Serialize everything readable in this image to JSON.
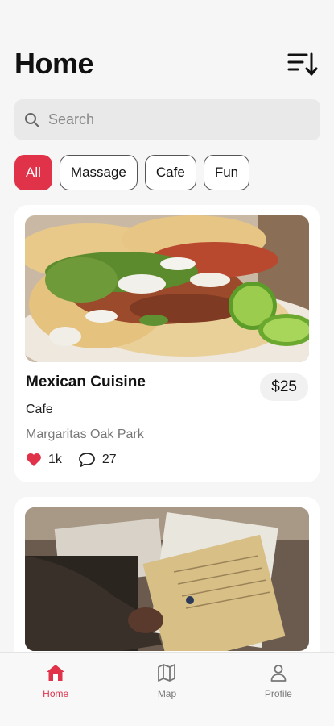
{
  "header": {
    "title": "Home"
  },
  "search": {
    "placeholder": "Search"
  },
  "filters": [
    {
      "label": "All",
      "active": true
    },
    {
      "label": "Massage",
      "active": false
    },
    {
      "label": "Cafe",
      "active": false
    },
    {
      "label": "Fun",
      "active": false
    }
  ],
  "cards": [
    {
      "title": "Mexican Cuisine",
      "price": "$25",
      "category": "Cafe",
      "location": "Margaritas Oak Park",
      "likes": "1k",
      "comments": "27",
      "image": "tacos-photo"
    },
    {
      "image": "old-documents-photo"
    }
  ],
  "tabs": [
    {
      "label": "Home",
      "icon": "home-icon",
      "active": true
    },
    {
      "label": "Map",
      "icon": "map-icon",
      "active": false
    },
    {
      "label": "Profile",
      "icon": "profile-icon",
      "active": false
    }
  ],
  "colors": {
    "accent": "#e0334a",
    "heart": "#e0334a"
  }
}
